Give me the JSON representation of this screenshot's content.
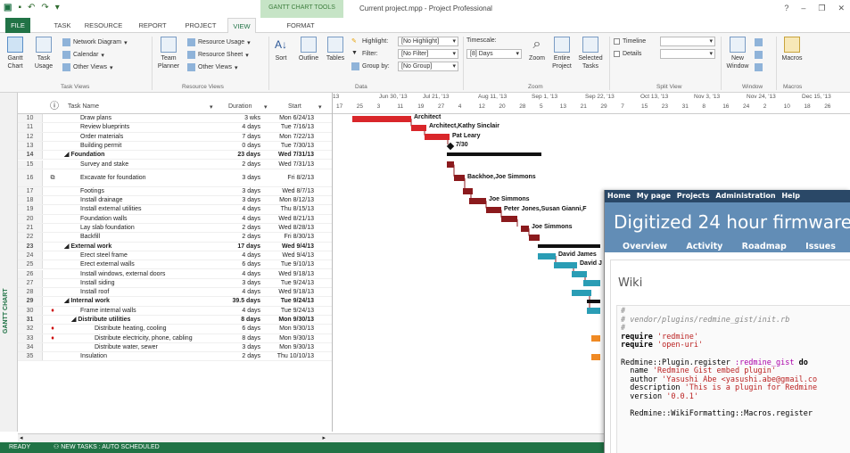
{
  "window": {
    "title": "Current project.mpp - Project Professional",
    "context_tab_title": "GANTT CHART TOOLS",
    "help": "?",
    "minimize": "–",
    "restore": "❐",
    "close": "✕"
  },
  "tabs": [
    {
      "label": "FILE"
    },
    {
      "label": "TASK"
    },
    {
      "label": "RESOURCE"
    },
    {
      "label": "REPORT"
    },
    {
      "label": "PROJECT"
    },
    {
      "label": "VIEW"
    },
    {
      "label": "FORMAT"
    }
  ],
  "ribbon": {
    "task_views": {
      "group_label": "Task Views",
      "gantt_chart": "Gantt Chart",
      "task_usage": "Task Usage",
      "network_diagram": "Network Diagram",
      "calendar": "Calendar",
      "other_views": "Other Views"
    },
    "resource_views": {
      "group_label": "Resource Views",
      "team_planner": "Team Planner",
      "resource_usage": "Resource Usage",
      "resource_sheet": "Resource Sheet",
      "other_views": "Other Views"
    },
    "data": {
      "group_label": "Data",
      "sort": "Sort",
      "outline": "Outline",
      "tables": "Tables",
      "highlight_label": "Highlight:",
      "highlight_value": "[No Highlight]",
      "filter_label": "Filter:",
      "filter_value": "[No Filter]",
      "group_label_text": "Group by:",
      "group_value": "[No Group]"
    },
    "zoom": {
      "group_label": "Zoom",
      "timescale_label": "Timescale:",
      "timescale_value": "[8] Days",
      "zoom": "Zoom",
      "entire_project": "Entire Project",
      "selected_tasks": "Selected Tasks"
    },
    "split_view": {
      "group_label": "Split View",
      "timeline": "Timeline",
      "details": "Details"
    },
    "window": {
      "group_label": "Window",
      "new_window": "New Window"
    },
    "macros": {
      "group_label": "Macros",
      "macros": "Macros"
    }
  },
  "sidebar": {
    "label": "GANTT CHART"
  },
  "grid": {
    "headers": {
      "task_name": "Task Name",
      "duration": "Duration",
      "start": "Start"
    },
    "rows": [
      {
        "id": "10",
        "name": "Draw plans",
        "duration": "3 wks",
        "start": "Mon 6/24/13"
      },
      {
        "id": "11",
        "name": "Review blueprints",
        "duration": "4 days",
        "start": "Tue 7/16/13"
      },
      {
        "id": "12",
        "name": "Order materials",
        "duration": "7 days",
        "start": "Mon 7/22/13"
      },
      {
        "id": "13",
        "name": "Building permit",
        "duration": "0 days",
        "start": "Tue 7/30/13"
      },
      {
        "id": "14",
        "name": "◢ Foundation",
        "duration": "23 days",
        "start": "Wed 7/31/13"
      },
      {
        "id": "15",
        "name": "Survey and stake",
        "duration": "2 days",
        "start": "Wed 7/31/13"
      },
      {
        "id": "16",
        "name": "Excavate for foundation",
        "duration": "3 days",
        "start": "Fri 8/2/13"
      },
      {
        "id": "17",
        "name": "Footings",
        "duration": "3 days",
        "start": "Wed 8/7/13"
      },
      {
        "id": "18",
        "name": "Install drainage",
        "duration": "3 days",
        "start": "Mon 8/12/13"
      },
      {
        "id": "19",
        "name": "Install external utilities",
        "duration": "4 days",
        "start": "Thu 8/15/13"
      },
      {
        "id": "20",
        "name": "Foundation walls",
        "duration": "4 days",
        "start": "Wed 8/21/13"
      },
      {
        "id": "21",
        "name": "Lay slab foundation",
        "duration": "2 days",
        "start": "Wed 8/28/13"
      },
      {
        "id": "22",
        "name": "Backfill",
        "duration": "2 days",
        "start": "Fri 8/30/13"
      },
      {
        "id": "23",
        "name": "◢ External work",
        "duration": "17 days",
        "start": "Wed 9/4/13"
      },
      {
        "id": "24",
        "name": "Erect steel frame",
        "duration": "4 days",
        "start": "Wed 9/4/13"
      },
      {
        "id": "25",
        "name": "Erect external walls",
        "duration": "6 days",
        "start": "Tue 9/10/13"
      },
      {
        "id": "26",
        "name": "Install windows, external doors",
        "duration": "4 days",
        "start": "Wed 9/18/13"
      },
      {
        "id": "27",
        "name": "Install siding",
        "duration": "3 days",
        "start": "Tue 9/24/13"
      },
      {
        "id": "28",
        "name": "Install roof",
        "duration": "4 days",
        "start": "Wed 9/18/13"
      },
      {
        "id": "29",
        "name": "◢ Internal work",
        "duration": "39.5 days",
        "start": "Tue 9/24/13"
      },
      {
        "id": "30",
        "name": "Frame internal walls",
        "duration": "4 days",
        "start": "Tue 9/24/13"
      },
      {
        "id": "31",
        "name": "◢ Distribute utilities",
        "duration": "8 days",
        "start": "Mon 9/30/13"
      },
      {
        "id": "32",
        "name": "Distribute heating, cooling",
        "duration": "6 days",
        "start": "Mon 9/30/13"
      },
      {
        "id": "33",
        "name": "Distribute electricity, phone, cabling",
        "duration": "8 days",
        "start": "Mon 9/30/13"
      },
      {
        "id": "34",
        "name": "Distribute water, sewer",
        "duration": "3 days",
        "start": "Mon 9/30/13"
      },
      {
        "id": "35",
        "name": "Insulation",
        "duration": "2 days",
        "start": "Thu 10/10/13"
      }
    ]
  },
  "timescale": {
    "major": [
      "13",
      "Jun 30, '13",
      "Jul 21, '13",
      "Aug 11, '13",
      "Sep 1, '13",
      "Sep 22, '13",
      "Oct 13, '13",
      "Nov 3, '13",
      "Nov 24, '13",
      "Dec 15, '13"
    ],
    "minor": [
      "17",
      "25",
      "3",
      "11",
      "19",
      "27",
      "4",
      "12",
      "20",
      "28",
      "5",
      "13",
      "21",
      "29",
      "7",
      "15",
      "23",
      "31",
      "8",
      "16",
      "24",
      "2",
      "10",
      "18",
      "26"
    ]
  },
  "gantt_labels": {
    "r10": "Architect",
    "r11": "Architect,Kathy Sinclair",
    "r12": "Pat Leary",
    "r13": "7/30",
    "r16": "Backhoe,Joe Simmons",
    "r18": "Joe Simmons",
    "r19": "Peter Jones,Susan Gianni,F",
    "r21": "Joe Simmons",
    "r24": "David James",
    "r25": "David J"
  },
  "status": {
    "ready": "READY",
    "new_tasks": "NEW TASKS : AUTO SCHEDULED"
  },
  "browser": {
    "topmenu": [
      "Home",
      "My page",
      "Projects",
      "Administration",
      "Help"
    ],
    "project_title": "Digitized 24 hour firmware",
    "menu": [
      "Overview",
      "Activity",
      "Roadmap",
      "Issues"
    ],
    "heading": "Wiki",
    "code": {
      "l1": "#",
      "l2": "# vendor/plugins/redmine_gist/init.rb",
      "l3": "#",
      "l4_kw": "require",
      "l4_str": "'redmine'",
      "l5_kw": "require",
      "l5_str": "'open-uri'",
      "l7_a": "Redmine::Plugin.register",
      "l7_sym": ":redmine_gist",
      "l7_do": "do",
      "l8_kw": "name",
      "l8_str": "'Redmine Gist embed plugin'",
      "l9_kw": "author",
      "l9_str": "'Yasushi Abe <yasushi.abe@gmail.co",
      "l10_kw": "description",
      "l10_str": "'This is a plugin for Redmine",
      "l11_kw": "version",
      "l11_str": "'0.0.1'",
      "l13_a": "Redmine::WikiFormatting::Macros.register"
    }
  },
  "colors": {
    "accent": "#217346",
    "bar_red": "#d9262a",
    "bar_darkred": "#8b1a1d",
    "bar_teal": "#2a9db5",
    "bar_orange": "#f08a24",
    "redmine_top": "#2a4867",
    "redmine_header": "#628db6"
  }
}
